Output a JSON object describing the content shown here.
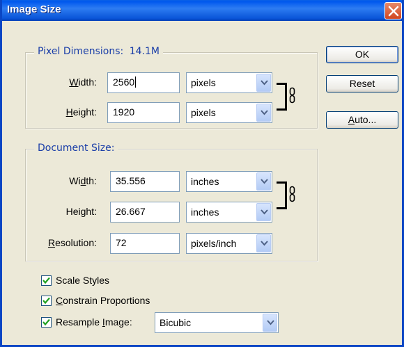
{
  "window": {
    "title": "Image Size"
  },
  "buttons": {
    "ok": "OK",
    "reset": "Reset",
    "auto": "Auto..."
  },
  "pixel_dimensions": {
    "legend": "Pixel Dimensions:",
    "size": "14.1M",
    "width_label": "Width:",
    "width_value": "2560",
    "width_unit": "pixels",
    "height_label": "Height:",
    "height_value": "1920",
    "height_unit": "pixels"
  },
  "document_size": {
    "legend": "Document Size:",
    "width_label": "Width:",
    "width_value": "35.556",
    "width_unit": "inches",
    "height_label": "Height:",
    "height_value": "26.667",
    "height_unit": "inches",
    "resolution_label": "Resolution:",
    "resolution_value": "72",
    "resolution_unit": "pixels/inch"
  },
  "options": {
    "scale_styles": {
      "label": "Scale Styles",
      "checked": true
    },
    "constrain_proportions": {
      "label": "Constrain Proportions",
      "checked": true
    },
    "resample_image": {
      "label": "Resample Image:",
      "checked": true,
      "method": "Bicubic"
    }
  },
  "colors": {
    "titlebar": "#0a5fe6",
    "legend_text": "#1a3ea8",
    "dialog_bg": "#ece9d8",
    "close_button": "#d2461f"
  }
}
